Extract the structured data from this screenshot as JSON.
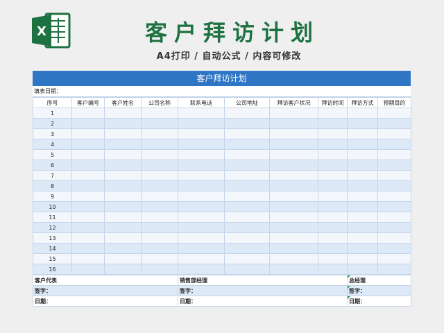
{
  "header": {
    "title": "客户拜访计划",
    "subtitle": "A4打印 / 自动公式 / 内容可修改",
    "icon": "excel-icon",
    "icon_color": "#1e7140"
  },
  "sheet": {
    "title": "客户拜访计划",
    "title_bg": "#2e75c4",
    "fill_date_label": "填表日期：",
    "columns": [
      "序号",
      "客户编号",
      "客户姓名",
      "公司名称",
      "联系电话",
      "公司地址",
      "拜访客户状况",
      "拜访时间",
      "拜访方式",
      "预期目的"
    ],
    "rows": [
      "1",
      "2",
      "3",
      "4",
      "5",
      "6",
      "7",
      "8",
      "9",
      "10",
      "11",
      "12",
      "13",
      "14",
      "15",
      "16"
    ]
  },
  "footer": {
    "rep_label": "客户代表",
    "sales_manager_label": "销售部经理",
    "gm_label": "总经理",
    "sign_label": "签字：",
    "date_label": "日期："
  }
}
